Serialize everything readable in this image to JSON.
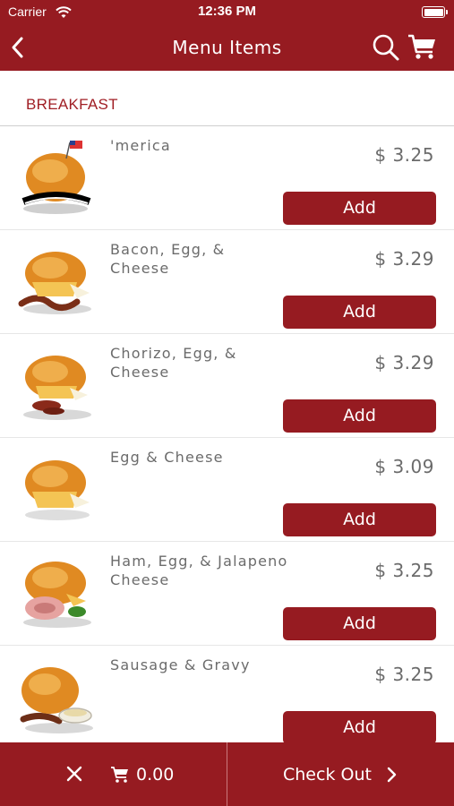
{
  "status": {
    "carrier": "Carrier",
    "time": "12:36 PM"
  },
  "nav": {
    "title": "Menu Items"
  },
  "section": {
    "label": "BREAKFAST"
  },
  "items": [
    {
      "name": "'merica",
      "price": "$ 3.25",
      "add_label": "Add"
    },
    {
      "name": "Bacon, Egg, & Cheese",
      "price": "$ 3.29",
      "add_label": "Add"
    },
    {
      "name": "Chorizo, Egg, & Cheese",
      "price": "$ 3.29",
      "add_label": "Add"
    },
    {
      "name": "Egg & Cheese",
      "price": "$ 3.09",
      "add_label": "Add"
    },
    {
      "name": "Ham, Egg, & Jalapeno Cheese",
      "price": "$ 3.25",
      "add_label": "Add"
    },
    {
      "name": "Sausage & Gravy",
      "price": "$ 3.25",
      "add_label": "Add"
    }
  ],
  "footer": {
    "total": "0.00",
    "checkout_label": "Check Out"
  },
  "colors": {
    "brand": "#961b21",
    "text_gray": "#6b6b6b",
    "section_red": "#a01e24"
  },
  "icons": [
    "wifi-icon",
    "battery-icon",
    "back-chevron-icon",
    "search-icon",
    "cart-icon",
    "close-icon",
    "cart-icon",
    "chevron-right-icon"
  ]
}
